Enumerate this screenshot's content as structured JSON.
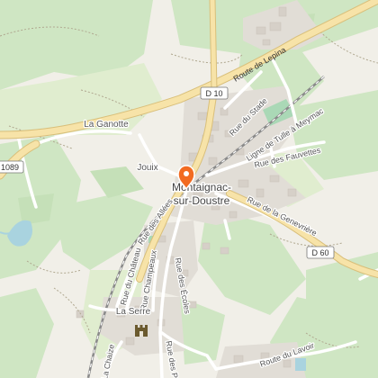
{
  "map": {
    "roads": {
      "route_de_lepina": "Route de Lepina",
      "d10": "D 10",
      "d60": "D 60",
      "d1089": "1089",
      "rue_du_stade": "Rue du Stade",
      "ligne_tulle_meymac": "Ligne de Tulle à Meymac",
      "rue_des_fauvettes": "Rue des Fauvettes",
      "rue_de_la_genevriere": "Rue de la Genevrière",
      "rue_des_allees": "Rue des Allées",
      "rue_du_chateau": "Rue du Château",
      "rue_champeaux": "Rue Champeaux",
      "rue_des_ecoles": "Rue des Écoles",
      "rue_des_p": "Rue des P",
      "la_chaize": "La Chaize",
      "route_du_lavoir": "Route du Lavoir"
    },
    "places": {
      "la_ganotte": "La Ganotte",
      "jouix": "Jouix",
      "town_line1": "Montaignac-",
      "town_line2": "sur-Doustre",
      "la_serre": "La Serre"
    },
    "marker": {
      "icon": "location-pin-icon",
      "color": "#f26b21"
    },
    "poi": {
      "icon": "castle-icon"
    },
    "colors": {
      "background": "#f1efe8",
      "forest": "#cfe6c3",
      "forest_dark": "#c5e0b8",
      "meadow": "#e0edcf",
      "residential": "#e1ddd6",
      "building": "#d6d0c8",
      "water": "#a9d3df",
      "pitch": "#aad8b6",
      "main_road": "#f7e3a8",
      "main_road_casing": "#d9bf7a",
      "minor_road": "#ffffff",
      "railway": "#8a8a8a",
      "path": "#b0a890"
    }
  }
}
